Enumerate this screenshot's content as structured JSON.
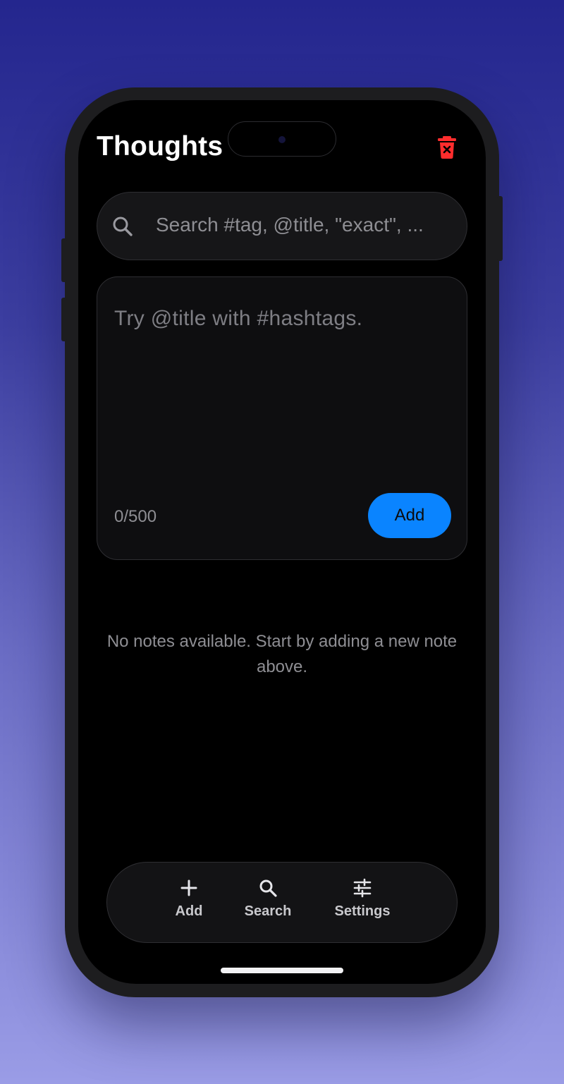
{
  "app": {
    "title": "Thoughts"
  },
  "header": {
    "delete_icon": "trash-x-icon",
    "delete_color": "#ff2d2d"
  },
  "search": {
    "placeholder": "Search #tag, @title, \"exact\", ...",
    "icon": "search-icon"
  },
  "composer": {
    "placeholder": "Try @title with #hashtags.",
    "counter": "0/500",
    "add_label": "Add",
    "accent": "#0a84ff"
  },
  "empty_state": {
    "message": "No notes available. Start by adding a new note above."
  },
  "nav": {
    "items": [
      {
        "label": "Add",
        "icon": "plus-icon"
      },
      {
        "label": "Search",
        "icon": "search-icon"
      },
      {
        "label": "Settings",
        "icon": "sliders-icon"
      }
    ]
  }
}
